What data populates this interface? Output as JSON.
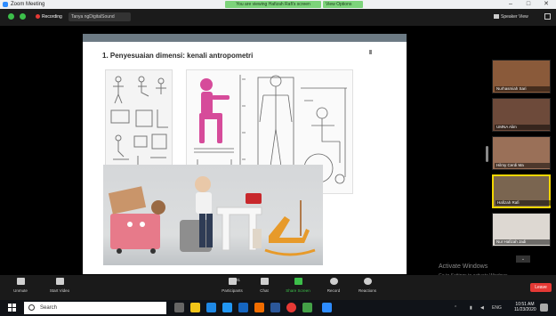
{
  "window": {
    "title": "Zoom Meeting",
    "share_status": "You are viewing Hafizah Rafi's screen",
    "view_options": "View Options"
  },
  "meeting": {
    "recording_label": "Recording",
    "rename_label": "Tanya ngDigitalSound",
    "speaker_view": "Speaker View"
  },
  "slide": {
    "title": "1.  Penyesuaian dimensi: kenali antropometri"
  },
  "participants": [
    {
      "name": "Nurhasmiah Sari"
    },
    {
      "name": "UMNA Alim"
    },
    {
      "name": "Hilmy Cerdi Ma"
    },
    {
      "name": "Hafizah Rafi"
    },
    {
      "name": "Nur Hafizah Jadi"
    }
  ],
  "activation": {
    "title": "Activate Windows",
    "subtitle": "Go to Settings to activate Windows."
  },
  "toolbar": {
    "unmute": "Unmute",
    "start_video": "Start Video",
    "participants": "Participants",
    "participants_count": "31",
    "chat": "Chat",
    "share_screen": "Share Screen",
    "record": "Record",
    "reactions": "Reactions",
    "end": "Leave"
  },
  "taskbar": {
    "search_placeholder": "Search",
    "time": "10:51 AM",
    "date": "11/23/2020",
    "lang": "ENG"
  },
  "colors": {
    "accent": "#2d8cff",
    "share_green": "#3cbf4a",
    "end_red": "#e53935",
    "active_speaker": "#f2d600"
  }
}
